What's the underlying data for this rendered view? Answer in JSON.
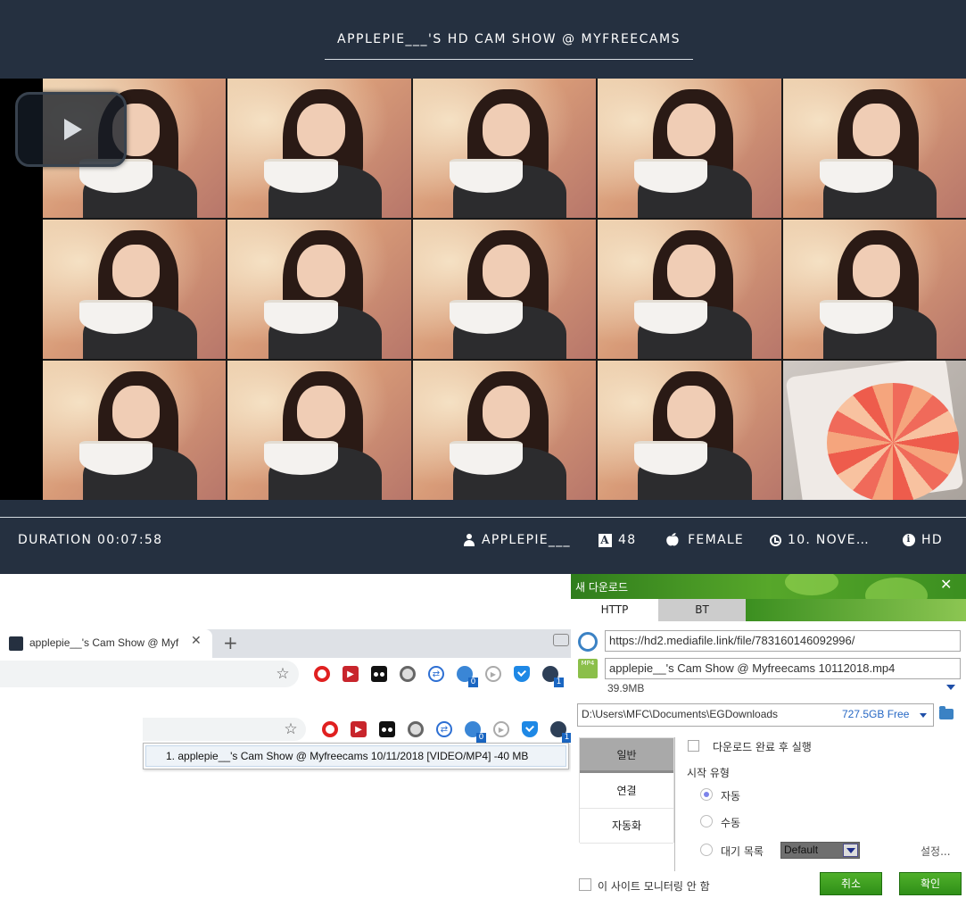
{
  "player": {
    "title": "APPLEPIE___'S HD CAM SHOW @ MYFREECAMS",
    "info": {
      "duration": "DURATION 00:07:58",
      "username": "APPLEPIE___",
      "age": "48",
      "gender": "FEMALE",
      "date": "10. NOVE…",
      "quality": "HD"
    }
  },
  "browser": {
    "tab_title": "applepie__'s Cam Show @ Myf",
    "close_glyph": "✕",
    "newtab_glyph": "+",
    "star_glyph": "☆",
    "badge_count_globe": "0",
    "badge_count_eg": "1",
    "download_menu_item": "1. applepie__'s Cam Show @ Myfreecams 10/11/2018 [VIDEO/MP4] -40 MB"
  },
  "dialog": {
    "title": "새 다운로드",
    "close_glyph": "✕",
    "tabs": [
      "HTTP",
      "BT"
    ],
    "url": "https://hd2.mediafile.link/file/783160146092996/",
    "filename": "applepie__'s Cam Show @ Myfreecams 10112018.mp4",
    "mp4_label": "MP4",
    "size": "39.9MB",
    "save_path": "D:\\Users\\MFC\\Documents\\EGDownloads",
    "free_space": "727.5GB Free",
    "side_nav": [
      "일반",
      "연결",
      "자동화"
    ],
    "run_after_download": "다운로드 완료 후 실행",
    "start_type_label": "시작 유형",
    "start_options": [
      "자동",
      "수동",
      "대기 목록"
    ],
    "queue_value": "Default",
    "settings_link": "설정...",
    "dont_monitor_site": "이 사이트 모니터링 안 함",
    "cancel_label": "취소",
    "ok_label": "확인"
  },
  "colors": {
    "header_bg": "#253040",
    "accent_green": "#3b8f20",
    "link_blue": "#2567c4"
  }
}
